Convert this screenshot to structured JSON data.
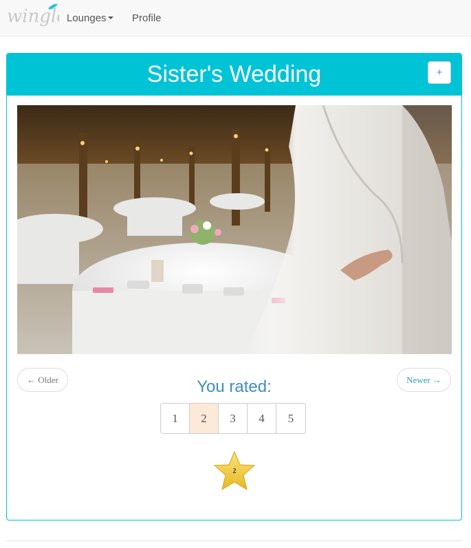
{
  "navbar": {
    "brand": "wingle",
    "lounges_label": "Lounges",
    "profile_label": "Profile"
  },
  "panel": {
    "title": "Sister's Wedding",
    "add_label": "+"
  },
  "pager": {
    "older_label": "← Older",
    "newer_label": "Newer →"
  },
  "rating": {
    "prompt": "You rated:",
    "options": [
      "1",
      "2",
      "3",
      "4",
      "5"
    ],
    "selected": "2",
    "star_label": "2"
  },
  "colors": {
    "accent": "#00c3d6",
    "link": "#3e8ebd",
    "selected_bg": "#fde9d8",
    "star": "#f5cf3d"
  }
}
